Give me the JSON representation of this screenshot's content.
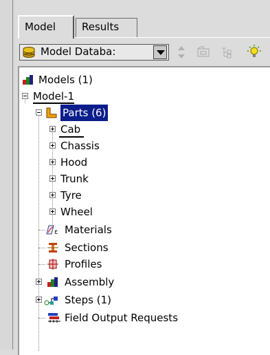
{
  "tabs": {
    "model": "Model",
    "results": "Results"
  },
  "toolbar": {
    "select_value": "Model Databa:"
  },
  "tree": {
    "models": "Models (1)",
    "model1": "Model-1",
    "parts": "Parts (6)",
    "part_items": [
      "Cab",
      "Chassis",
      "Hood",
      "Trunk",
      "Tyre",
      "Wheel"
    ],
    "materials": "Materials",
    "sections": "Sections",
    "profiles": "Profiles",
    "assembly": "Assembly",
    "steps": "Steps (1)",
    "field_output": "Field Output Requests"
  },
  "colors": {
    "selection": "#0c1e8c",
    "parts_icon": "#f0a000"
  }
}
